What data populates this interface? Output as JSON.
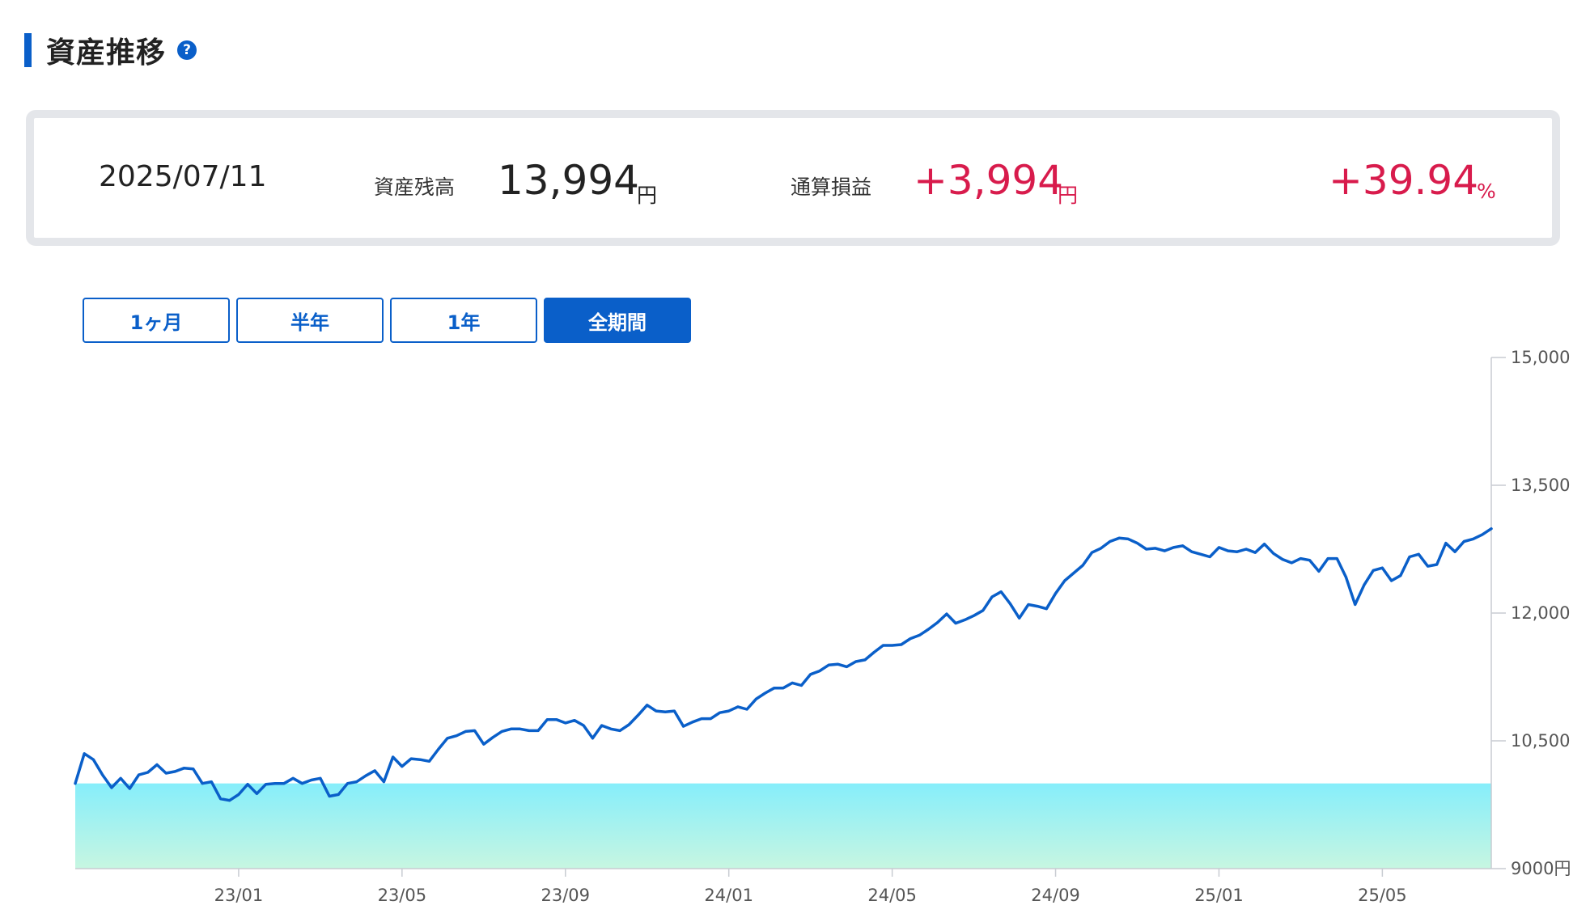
{
  "section": {
    "title": "資産推移",
    "help_icon": "?"
  },
  "summary": {
    "date": "2025/07/11",
    "balance_label": "資産残高",
    "balance_value": "13,994",
    "balance_unit": "円",
    "pl_label": "通算損益",
    "pl_value": "+3,994",
    "pl_unit": "円",
    "pct_value": "+39.94",
    "pct_unit": "%"
  },
  "periods": {
    "items": [
      "1ヶ月",
      "半年",
      "1年",
      "全期間"
    ],
    "selected": "全期間"
  },
  "colors": {
    "accent": "#0a5fc9",
    "positive": "#d81b4c",
    "line": "#0a5fc9",
    "area_top": "#86eefb",
    "area_bottom": "#c7f6e1"
  },
  "chart_data": {
    "type": "line",
    "ylim": [
      9000,
      15000
    ],
    "yticks": [
      {
        "value": 15000,
        "label": "15,000"
      },
      {
        "value": 13500,
        "label": "13,500"
      },
      {
        "value": 12000,
        "label": "12,000"
      },
      {
        "value": 10500,
        "label": "10,500"
      },
      {
        "value": 9000,
        "label": "9000円"
      }
    ],
    "xticks": [
      {
        "index": 18,
        "label": "23/01"
      },
      {
        "index": 36,
        "label": "23/05"
      },
      {
        "index": 54,
        "label": "23/09"
      },
      {
        "index": 72,
        "label": "24/01"
      },
      {
        "index": 90,
        "label": "24/05"
      },
      {
        "index": 108,
        "label": "24/09"
      },
      {
        "index": 126,
        "label": "25/01"
      },
      {
        "index": 144,
        "label": "25/05"
      }
    ],
    "baseline": 10000,
    "series": [
      {
        "values": [
          10000,
          10350,
          10280,
          10100,
          9950,
          10060,
          9940,
          10100,
          10130,
          10220,
          10120,
          10140,
          10180,
          10170,
          10000,
          10020,
          9820,
          9800,
          9870,
          9990,
          9880,
          9990,
          10000,
          10000,
          10060,
          10000,
          10040,
          10060,
          9850,
          9870,
          10000,
          10020,
          10090,
          10150,
          10020,
          10310,
          10200,
          10290,
          10280,
          10260,
          10400,
          10530,
          10560,
          10610,
          10620,
          10460,
          10540,
          10610,
          10640,
          10640,
          10620,
          10620,
          10750,
          10750,
          10710,
          10740,
          10680,
          10530,
          10680,
          10640,
          10620,
          10690,
          10800,
          10920,
          10850,
          10840,
          10850,
          10670,
          10720,
          10760,
          10760,
          10830,
          10850,
          10900,
          10870,
          10990,
          11060,
          11120,
          11120,
          11180,
          11150,
          11280,
          11320,
          11390,
          11400,
          11370,
          11430,
          11450,
          11540,
          11620,
          11620,
          11630,
          11700,
          11740,
          11810,
          11890,
          11990,
          11880,
          11920,
          11970,
          12030,
          12190,
          12250,
          12110,
          11940,
          12100,
          12080,
          12050,
          12230,
          12380,
          12470,
          12560,
          12710,
          12760,
          12840,
          12880,
          12870,
          12820,
          12750,
          12760,
          12730,
          12770,
          12790,
          12720,
          12690,
          12660,
          12770,
          12730,
          12720,
          12750,
          12710,
          12810,
          12700,
          12630,
          12590,
          12640,
          12620,
          12490,
          12640,
          12640,
          12420,
          12100,
          12330,
          12500,
          12530,
          12380,
          12440,
          12660,
          12690,
          12550,
          12570,
          12820,
          12720,
          12840,
          12870,
          12920,
          12990
        ]
      }
    ]
  }
}
